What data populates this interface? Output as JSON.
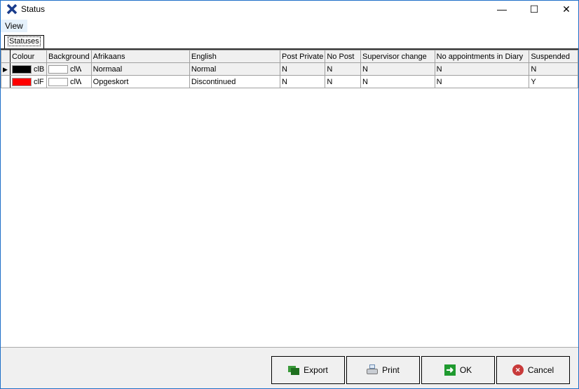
{
  "window": {
    "title": "Status",
    "minimize": "—",
    "maximize": "☐",
    "close": "✕"
  },
  "menu": {
    "view": "View"
  },
  "tabs": [
    {
      "label": "Statuses"
    }
  ],
  "grid": {
    "columns": [
      "Colour",
      "Background",
      "Afrikaans",
      "English",
      "Post Private",
      "No Post",
      "Supervisor change",
      "No appointments in Diary",
      "Suspended"
    ],
    "rows": [
      {
        "colour": "#000000",
        "colour_name": "clB",
        "background": "#ffffff",
        "background_name": "clWh",
        "afrikaans": "Normaal",
        "english": "Normal",
        "post_private": "N",
        "no_post": "N",
        "supervisor_change": "N",
        "no_appointments": "N",
        "suspended": "N",
        "selected": true
      },
      {
        "colour": "#ff0000",
        "colour_name": "clF",
        "background": "#ffffff",
        "background_name": "clWh",
        "afrikaans": "Opgeskort",
        "english": "Discontinued",
        "post_private": "N",
        "no_post": "N",
        "supervisor_change": "N",
        "no_appointments": "N",
        "suspended": "Y",
        "selected": false
      }
    ]
  },
  "buttons": {
    "export": "Export",
    "print": "Print",
    "ok": "OK",
    "cancel": "Cancel"
  }
}
